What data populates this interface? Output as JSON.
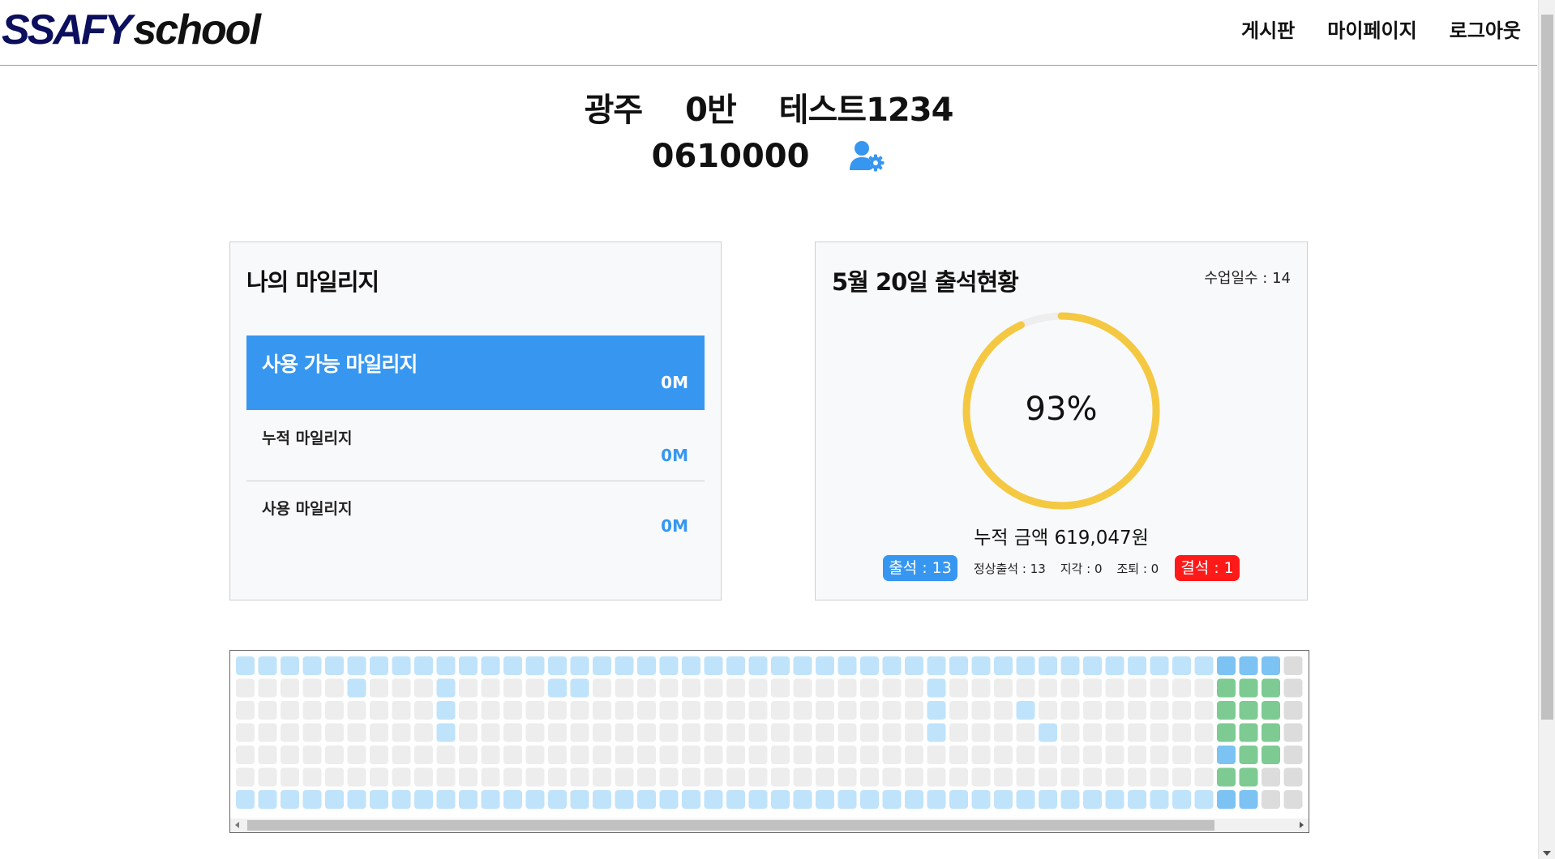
{
  "nav": {
    "logo_part1": "SSAFY",
    "logo_part2": "school",
    "links": [
      "게시판",
      "마이페이지",
      "로그아웃"
    ]
  },
  "profile": {
    "region": "광주",
    "class": "0반",
    "name": "테스트1234",
    "student_id": "0610000",
    "settings_icon": "user-cog-icon"
  },
  "mileage": {
    "title": "나의 마일리지",
    "available_label": "사용 가능 마일리지",
    "available_value": "0M",
    "accumulated_label": "누적 마일리지",
    "accumulated_value": "0M",
    "used_label": "사용 마일리지",
    "used_value": "0M"
  },
  "attendance": {
    "title": "5월 20일 출석현황",
    "class_days": "수업일수 : 14",
    "percent": 93,
    "percent_label": "93%",
    "accumulated_amount": "누적 금액 619,047원",
    "present": "출석 : 13",
    "normal": "정상출석 : 13",
    "late": "지각 : 0",
    "early_leave": "조퇴 : 0",
    "absent": "결석 : 1"
  },
  "colors": {
    "primary": "#3797f0",
    "donut_fill": "#f5c842",
    "donut_track": "#eeeeee",
    "absent": "#ff1a1a",
    "cell_empty": "#ededed",
    "cell_light_blue": "#bfe3fb",
    "cell_blue": "#7cc3f3",
    "cell_green": "#7dcb93",
    "cell_gray": "#dcdcdc"
  },
  "heatmap": {
    "columns": 48,
    "rows": 7,
    "first_column_start_row": 1,
    "cells": {
      "light_blue": [
        [
          0,
          0
        ],
        [
          1,
          0
        ],
        [
          2,
          0
        ],
        [
          3,
          0
        ],
        [
          4,
          0
        ],
        [
          5,
          0
        ],
        [
          6,
          0
        ],
        [
          7,
          0
        ],
        [
          8,
          0
        ],
        [
          9,
          0
        ],
        [
          10,
          0
        ],
        [
          11,
          0
        ],
        [
          12,
          0
        ],
        [
          13,
          0
        ],
        [
          14,
          0
        ],
        [
          15,
          0
        ],
        [
          16,
          0
        ],
        [
          17,
          0
        ],
        [
          18,
          0
        ],
        [
          19,
          0
        ],
        [
          20,
          0
        ],
        [
          21,
          0
        ],
        [
          22,
          0
        ],
        [
          23,
          0
        ],
        [
          24,
          0
        ],
        [
          25,
          0
        ],
        [
          26,
          0
        ],
        [
          27,
          0
        ],
        [
          28,
          0
        ],
        [
          29,
          0
        ],
        [
          30,
          0
        ],
        [
          31,
          0
        ],
        [
          32,
          0
        ],
        [
          33,
          0
        ],
        [
          34,
          0
        ],
        [
          35,
          0
        ],
        [
          36,
          0
        ],
        [
          37,
          0
        ],
        [
          38,
          0
        ],
        [
          39,
          0
        ],
        [
          40,
          0
        ],
        [
          41,
          0
        ],
        [
          42,
          0
        ],
        [
          43,
          0
        ],
        [
          5,
          1
        ],
        [
          9,
          1
        ],
        [
          14,
          1
        ],
        [
          15,
          1
        ],
        [
          31,
          1
        ],
        [
          9,
          2
        ],
        [
          31,
          2
        ],
        [
          35,
          2
        ],
        [
          9,
          3
        ],
        [
          31,
          3
        ],
        [
          36,
          3
        ],
        [
          0,
          6
        ],
        [
          1,
          6
        ],
        [
          2,
          6
        ],
        [
          3,
          6
        ],
        [
          4,
          6
        ],
        [
          5,
          6
        ],
        [
          6,
          6
        ],
        [
          7,
          6
        ],
        [
          8,
          6
        ],
        [
          9,
          6
        ],
        [
          10,
          6
        ],
        [
          11,
          6
        ],
        [
          12,
          6
        ],
        [
          13,
          6
        ],
        [
          14,
          6
        ],
        [
          15,
          6
        ],
        [
          16,
          6
        ],
        [
          17,
          6
        ],
        [
          18,
          6
        ],
        [
          19,
          6
        ],
        [
          20,
          6
        ],
        [
          21,
          6
        ],
        [
          22,
          6
        ],
        [
          23,
          6
        ],
        [
          24,
          6
        ],
        [
          25,
          6
        ],
        [
          26,
          6
        ],
        [
          27,
          6
        ],
        [
          28,
          6
        ],
        [
          29,
          6
        ],
        [
          30,
          6
        ],
        [
          31,
          6
        ],
        [
          32,
          6
        ],
        [
          33,
          6
        ],
        [
          34,
          6
        ],
        [
          35,
          6
        ],
        [
          36,
          6
        ],
        [
          37,
          6
        ],
        [
          38,
          6
        ],
        [
          39,
          6
        ],
        [
          40,
          6
        ],
        [
          41,
          6
        ],
        [
          42,
          6
        ],
        [
          43,
          6
        ]
      ],
      "blue": [
        [
          44,
          0
        ],
        [
          45,
          0
        ],
        [
          46,
          0
        ],
        [
          44,
          4
        ],
        [
          44,
          6
        ],
        [
          45,
          6
        ]
      ],
      "green": [
        [
          44,
          1
        ],
        [
          45,
          1
        ],
        [
          46,
          1
        ],
        [
          44,
          2
        ],
        [
          45,
          2
        ],
        [
          46,
          2
        ],
        [
          44,
          3
        ],
        [
          45,
          3
        ],
        [
          46,
          3
        ],
        [
          45,
          4
        ],
        [
          46,
          4
        ],
        [
          44,
          5
        ],
        [
          45,
          5
        ]
      ],
      "gray": [
        [
          47,
          0
        ],
        [
          47,
          1
        ],
        [
          47,
          2
        ],
        [
          47,
          3
        ],
        [
          47,
          4
        ],
        [
          47,
          5
        ],
        [
          47,
          6
        ],
        [
          46,
          5
        ],
        [
          46,
          6
        ]
      ]
    }
  }
}
